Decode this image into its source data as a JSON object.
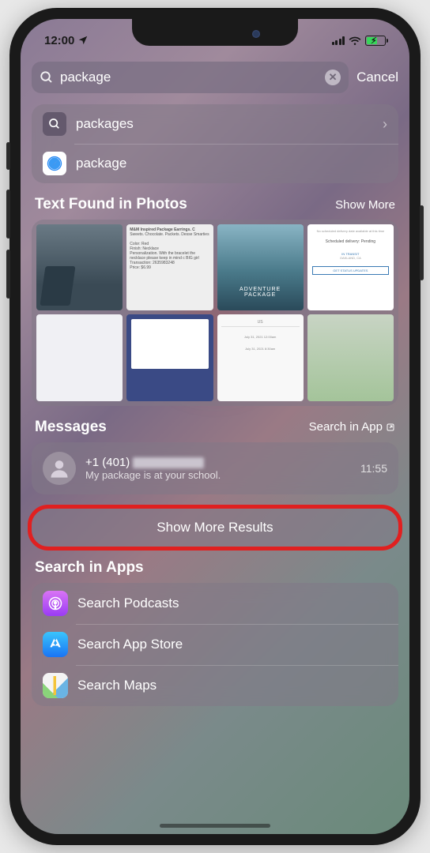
{
  "status": {
    "time": "12:00"
  },
  "search": {
    "query": "package",
    "cancel": "Cancel"
  },
  "suggestions": [
    {
      "icon": "search",
      "label": "packages",
      "chevron": true
    },
    {
      "icon": "safari",
      "label": "package",
      "chevron": false
    }
  ],
  "photos_section": {
    "title": "Text Found in Photos",
    "action": "Show More"
  },
  "photo_tiles": {
    "p2": {
      "title": "M&M Inspired Package Earrings. C",
      "sub": "Sweets. Chocolate. Packets. Desse Smarties",
      "color_lbl": "Color: Red",
      "finish": "Finish: Necklace",
      "pers": "Personalization. With the bracelet the necklace please keep in mind c BIG girl",
      "trans": "Transaction: 2635983248",
      "price": "Price: $6.99"
    },
    "p3": {
      "line1": "ADVENTURE",
      "line2": "PACKAGE"
    },
    "p4": {
      "title": "No scheduled delivery date available at this time",
      "status": "Scheduled delivery: Pending",
      "badge": "IN TRANSIT",
      "loc": "OAKLAND, CA",
      "btn": "GET STATUS UPDATES"
    },
    "p7": {
      "us": "US",
      "d1": "July 31, 2021 12:00am",
      "d2": "July 31, 2021 8:30am"
    }
  },
  "messages_section": {
    "title": "Messages",
    "action": "Search in App"
  },
  "message": {
    "from_prefix": "+1 (401)",
    "preview": "My package is at your school.",
    "time": "11:55"
  },
  "show_more": "Show More Results",
  "apps_section": {
    "title": "Search in Apps"
  },
  "apps": [
    {
      "icon": "podcasts",
      "label": "Search Podcasts"
    },
    {
      "icon": "appstore",
      "label": "Search App Store"
    },
    {
      "icon": "maps",
      "label": "Search Maps"
    }
  ]
}
